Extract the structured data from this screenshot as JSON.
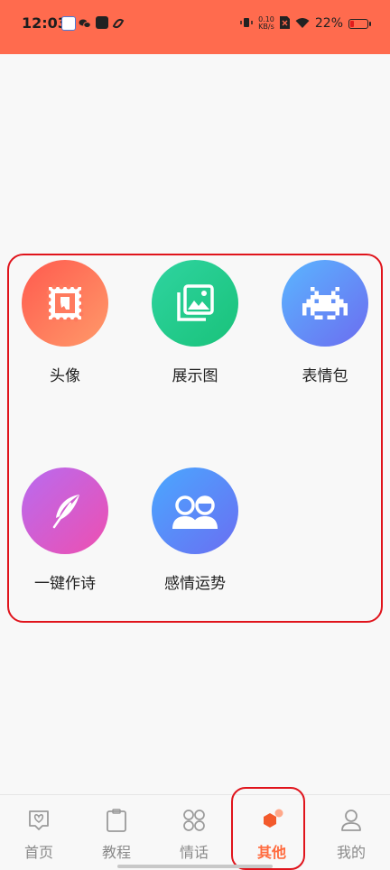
{
  "status": {
    "time": "12:03",
    "net_value": "0.10",
    "net_unit": "KB/s",
    "battery": "22%",
    "battery_level": 0.22
  },
  "grid": {
    "items": [
      {
        "label": "头像",
        "icon": "stamp-photo-icon"
      },
      {
        "label": "展示图",
        "icon": "image-gallery-icon"
      },
      {
        "label": "表情包",
        "icon": "space-invader-icon"
      },
      {
        "label": "一键作诗",
        "icon": "feather-quill-icon"
      },
      {
        "label": "感情运势",
        "icon": "couple-icon"
      }
    ]
  },
  "tabs": [
    {
      "label": "首页",
      "icon": "heart-home-icon"
    },
    {
      "label": "教程",
      "icon": "clipboard-icon"
    },
    {
      "label": "情话",
      "icon": "four-circles-icon"
    },
    {
      "label": "其他",
      "icon": "hexagon-icon",
      "active": true
    },
    {
      "label": "我的",
      "icon": "user-icon"
    }
  ],
  "colors": {
    "status_bar": "#ff6b4e",
    "highlight": "#e0141c",
    "tab_active": "#ff6a3d",
    "tab_inactive": "#8a8a8a"
  }
}
